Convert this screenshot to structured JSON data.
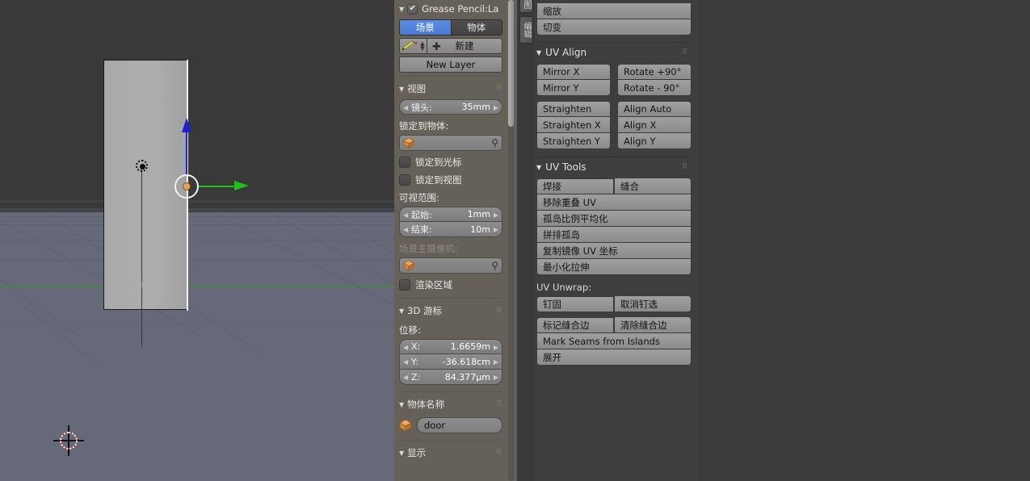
{
  "app": "blender-3d-uv-editing",
  "viewport": {
    "name": "3d-viewport",
    "object_name": "door",
    "colors": {
      "sky": "#393939",
      "floor": "#666a78",
      "grid": "#5c606d",
      "y_axis": "#24a024",
      "z_axis": "#2020d0",
      "origin": "#e0a45c"
    }
  },
  "props": {
    "grease_pencil": {
      "header": "Grease Pencil:La",
      "checkbox_checked": true,
      "toggle_scene": "场景",
      "toggle_object": "物体",
      "new_button": "新建",
      "new_layer_button": "New Layer"
    },
    "view": {
      "header": "视图",
      "lens_label": "镜头:",
      "lens_value": "35mm",
      "lock_to_object_label": "锁定到物体:",
      "lock_object_value": "",
      "lock_to_cursor": "锁定到光标",
      "lock_to_view": "锁定到视图",
      "clip_label": "可视范围:",
      "clip_start_label": "起始:",
      "clip_start_value": "1mm",
      "clip_end_label": "结束:",
      "clip_end_value": "10m",
      "scene_camera_label": "场景主摄像机:",
      "scene_camera_value": "",
      "render_border": "渲染区域"
    },
    "cursor3d": {
      "header": "3D 游标",
      "location_label": "位移:",
      "x_label": "X:",
      "x_value": "1.6659m",
      "y_label": "Y:",
      "y_value": "-36.618cm",
      "z_label": "Z:",
      "z_value": "84.377µm"
    },
    "item": {
      "header": "物体名称",
      "name_value": "door"
    },
    "display": {
      "header": "显示"
    }
  },
  "uvtools": {
    "vertical_tabs": [
      "视图",
      "编辑"
    ],
    "top_partial_buttons": [
      "缩放",
      "切变"
    ],
    "uv_align": {
      "header": "UV Align",
      "left": [
        "Mirror X",
        "Mirror Y"
      ],
      "right": [
        "Rotate +90°",
        "Rotate  - 90°"
      ],
      "left2": [
        "Straighten",
        "Straighten X",
        "Straighten Y"
      ],
      "right2": [
        "Align Auto",
        "Align X",
        "Align Y"
      ]
    },
    "uv_tools": {
      "header": "UV Tools",
      "row1": [
        "焊接",
        "缝合"
      ],
      "list": [
        "移除重叠 UV",
        "孤岛比例平均化",
        "拼排孤岛",
        "复制镜像 UV 坐标",
        "最小化拉伸"
      ]
    },
    "uv_unwrap": {
      "label": "UV Unwrap:",
      "row1": [
        "钉固",
        "取消钉选"
      ],
      "row2": [
        "标记缝合边",
        "清除缝合边"
      ],
      "row3": "Mark Seams from Islands",
      "row4": "展开"
    }
  },
  "uv_editor": {
    "name": "uv-image-editor",
    "selected_edge_color": "#f08a1e"
  }
}
